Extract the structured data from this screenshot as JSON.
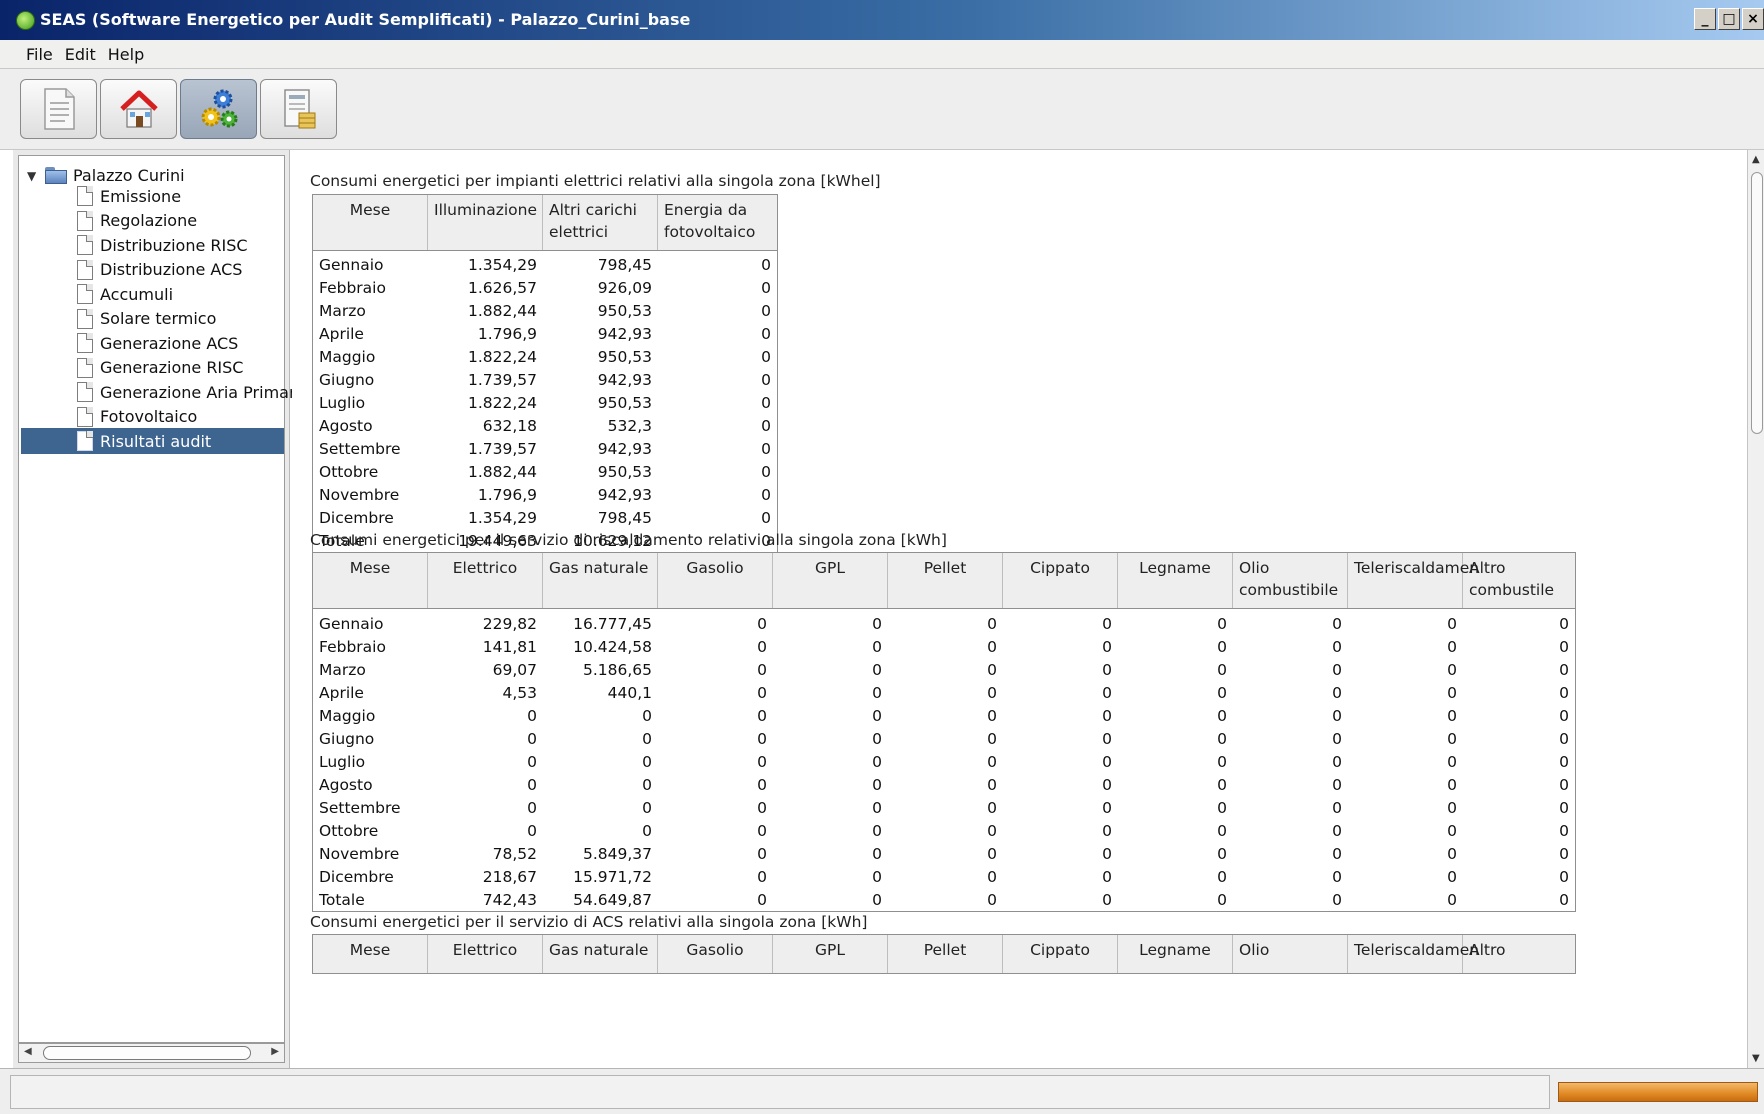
{
  "window": {
    "title": "SEAS (Software Energetico per Audit Semplificati) - Palazzo_Curini_base",
    "buttons": [
      "_",
      "□",
      "×"
    ]
  },
  "menu": [
    "File",
    "Edit",
    "Help"
  ],
  "toolbar": [
    {
      "name": "new-document",
      "icon": "document-icon"
    },
    {
      "name": "building",
      "icon": "house-icon"
    },
    {
      "name": "calculation",
      "icon": "gears-icon",
      "active": true
    },
    {
      "name": "report",
      "icon": "report-icon"
    }
  ],
  "tree": {
    "root": "Palazzo Curini",
    "items": [
      "Emissione",
      "Regolazione",
      "Distribuzione RISC",
      "Distribuzione ACS",
      "Accumuli",
      "Solare termico",
      "Generazione ACS",
      "Generazione RISC",
      "Generazione Aria Primaria",
      "Fotovoltaico",
      "Risultati audit"
    ],
    "selected": "Risultati audit"
  },
  "section1": {
    "title": "Consumi energetici per impianti elettrici relativi alla singola zona [kWhel]",
    "columns": [
      "Mese",
      "Illuminazione",
      "Altri carichi elettrici",
      "Energia da fotovoltaico"
    ],
    "rows": [
      [
        "Gennaio",
        "1.354,29",
        "798,45",
        "0"
      ],
      [
        "Febbraio",
        "1.626,57",
        "926,09",
        "0"
      ],
      [
        "Marzo",
        "1.882,44",
        "950,53",
        "0"
      ],
      [
        "Aprile",
        "1.796,9",
        "942,93",
        "0"
      ],
      [
        "Maggio",
        "1.822,24",
        "950,53",
        "0"
      ],
      [
        "Giugno",
        "1.739,57",
        "942,93",
        "0"
      ],
      [
        "Luglio",
        "1.822,24",
        "950,53",
        "0"
      ],
      [
        "Agosto",
        "632,18",
        "532,3",
        "0"
      ],
      [
        "Settembre",
        "1.739,57",
        "942,93",
        "0"
      ],
      [
        "Ottobre",
        "1.882,44",
        "950,53",
        "0"
      ],
      [
        "Novembre",
        "1.796,9",
        "942,93",
        "0"
      ],
      [
        "Dicembre",
        "1.354,29",
        "798,45",
        "0"
      ],
      [
        "Totale",
        "19.449,63",
        "10.629,12",
        "0"
      ]
    ]
  },
  "section2": {
    "title": "Consumi energetici per il servizio di riscaldamento relativi alla singola zona [kWh]",
    "columns": [
      "Mese",
      "Elettrico",
      "Gas naturale",
      "Gasolio",
      "GPL",
      "Pellet",
      "Cippato",
      "Legname",
      "Olio combustibile",
      "Teleriscaldamen",
      "Altro combustile"
    ],
    "rows": [
      [
        "Gennaio",
        "229,82",
        "16.777,45",
        "0",
        "0",
        "0",
        "0",
        "0",
        "0",
        "0",
        "0"
      ],
      [
        "Febbraio",
        "141,81",
        "10.424,58",
        "0",
        "0",
        "0",
        "0",
        "0",
        "0",
        "0",
        "0"
      ],
      [
        "Marzo",
        "69,07",
        "5.186,65",
        "0",
        "0",
        "0",
        "0",
        "0",
        "0",
        "0",
        "0"
      ],
      [
        "Aprile",
        "4,53",
        "440,1",
        "0",
        "0",
        "0",
        "0",
        "0",
        "0",
        "0",
        "0"
      ],
      [
        "Maggio",
        "0",
        "0",
        "0",
        "0",
        "0",
        "0",
        "0",
        "0",
        "0",
        "0"
      ],
      [
        "Giugno",
        "0",
        "0",
        "0",
        "0",
        "0",
        "0",
        "0",
        "0",
        "0",
        "0"
      ],
      [
        "Luglio",
        "0",
        "0",
        "0",
        "0",
        "0",
        "0",
        "0",
        "0",
        "0",
        "0"
      ],
      [
        "Agosto",
        "0",
        "0",
        "0",
        "0",
        "0",
        "0",
        "0",
        "0",
        "0",
        "0"
      ],
      [
        "Settembre",
        "0",
        "0",
        "0",
        "0",
        "0",
        "0",
        "0",
        "0",
        "0",
        "0"
      ],
      [
        "Ottobre",
        "0",
        "0",
        "0",
        "0",
        "0",
        "0",
        "0",
        "0",
        "0",
        "0"
      ],
      [
        "Novembre",
        "78,52",
        "5.849,37",
        "0",
        "0",
        "0",
        "0",
        "0",
        "0",
        "0",
        "0"
      ],
      [
        "Dicembre",
        "218,67",
        "15.971,72",
        "0",
        "0",
        "0",
        "0",
        "0",
        "0",
        "0",
        "0"
      ],
      [
        "Totale",
        "742,43",
        "54.649,87",
        "0",
        "0",
        "0",
        "0",
        "0",
        "0",
        "0",
        "0"
      ]
    ]
  },
  "section3": {
    "title": "Consumi energetici per il servizio di ACS relativi alla singola zona [kWh]",
    "columns": [
      "Mese",
      "Elettrico",
      "Gas naturale",
      "Gasolio",
      "GPL",
      "Pellet",
      "Cippato",
      "Legname",
      "Olio",
      "Teleriscaldamen",
      "Altro"
    ]
  },
  "colors": {
    "selection": "#3e6490",
    "progress": "#e08a24",
    "title_start": "#0a246a"
  }
}
